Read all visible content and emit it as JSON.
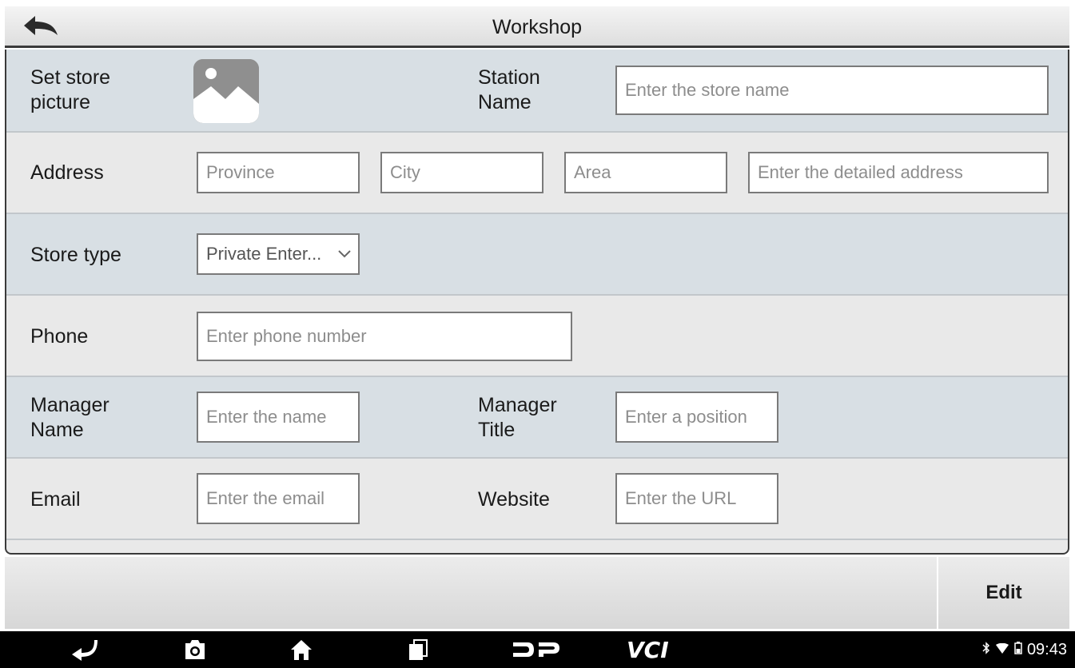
{
  "header": {
    "title": "Workshop",
    "back_icon": "back-arrow-icon"
  },
  "form": {
    "store_picture": {
      "label": "Set store\npicture",
      "icon": "image-placeholder-icon"
    },
    "station_name": {
      "label": "Station\nName",
      "placeholder": "Enter the store name",
      "value": ""
    },
    "address": {
      "label": "Address",
      "province_placeholder": "Province",
      "city_placeholder": "City",
      "area_placeholder": "Area",
      "detail_placeholder": "Enter the detailed address"
    },
    "store_type": {
      "label": "Store type",
      "selected": "Private Enter..."
    },
    "phone": {
      "label": "Phone",
      "placeholder": "Enter phone number"
    },
    "manager_name": {
      "label": "Manager\nName",
      "placeholder": "Enter the name"
    },
    "manager_title": {
      "label": "Manager\nTitle",
      "placeholder": "Enter a position"
    },
    "email": {
      "label": "Email",
      "placeholder": "Enter the email"
    },
    "website": {
      "label": "Website",
      "placeholder": "Enter the URL"
    }
  },
  "actions": {
    "edit_label": "Edit"
  },
  "navbar": {
    "icons": [
      "return-icon",
      "camera-icon",
      "home-icon",
      "recent-apps-icon",
      "dp-logo-icon"
    ],
    "vci_label": "VCI",
    "status_icons": [
      "bluetooth-icon",
      "wifi-icon",
      "battery-icon"
    ],
    "time": "09:43"
  },
  "colors": {
    "row_blue": "#d8dfe4",
    "row_grey": "#e9e9e9",
    "border_dark": "#3a3a3a"
  }
}
